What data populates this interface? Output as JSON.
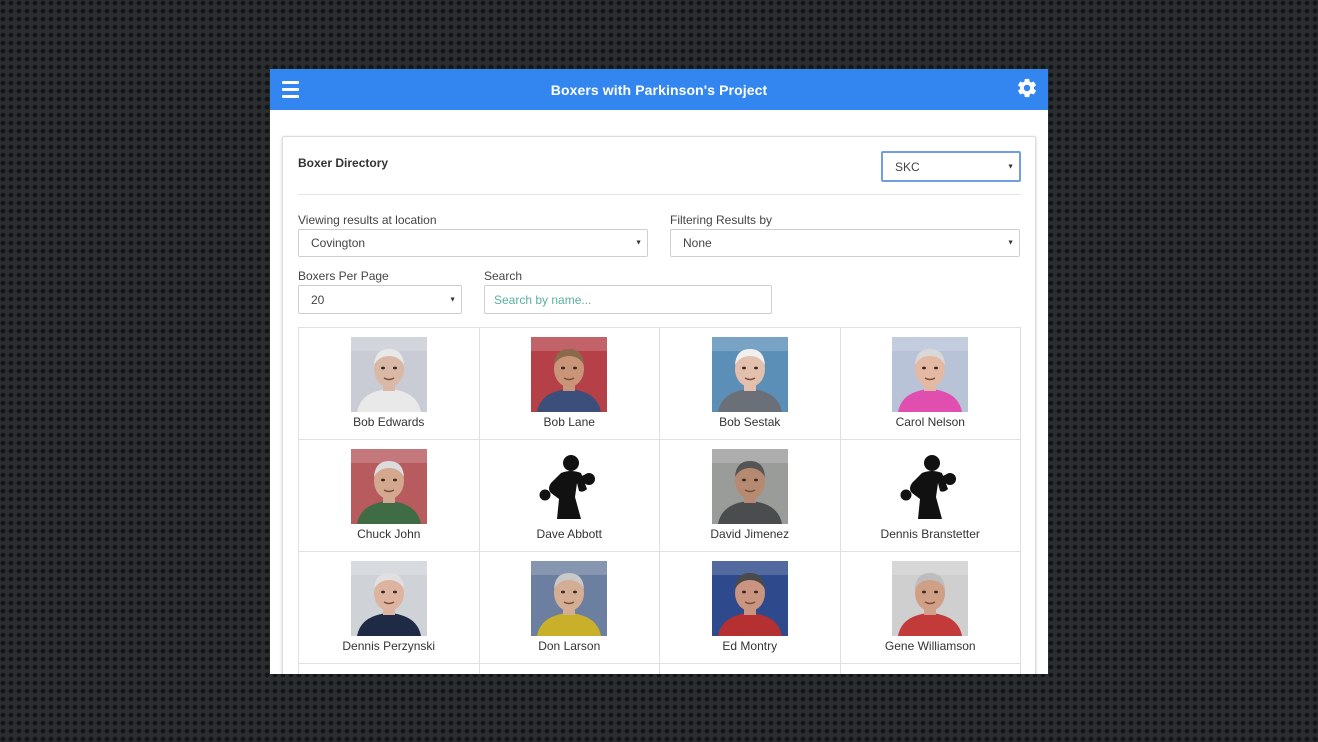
{
  "app": {
    "title": "Boxers with Parkinson's Project"
  },
  "directory": {
    "title": "Boxer Directory",
    "group_value": "SKC",
    "location_label": "Viewing results at location",
    "location_value": "Covington",
    "filter_label": "Filtering Results by",
    "filter_value": "None",
    "perpage_label": "Boxers Per Page",
    "perpage_value": "20",
    "search_label": "Search",
    "search_placeholder": "Search by name..."
  },
  "boxers": [
    {
      "name": "Bob Edwards",
      "photo": "photo",
      "bg": "#c9ccd4",
      "skin": "#d9b9a6",
      "hair": "#e8e8e8",
      "shirt": "#e9e9e9"
    },
    {
      "name": "Bob Lane",
      "photo": "photo",
      "bg": "#b54048",
      "skin": "#c99478",
      "hair": "#8a6a4a",
      "shirt": "#3b4f7a"
    },
    {
      "name": "Bob Sestak",
      "photo": "photo",
      "bg": "#5c8fb8",
      "skin": "#e2c0ad",
      "hair": "#f0f0f0",
      "shirt": "#6a6f78"
    },
    {
      "name": "Carol Nelson",
      "photo": "photo",
      "bg": "#b8c3d8",
      "skin": "#e3b9a3",
      "hair": "#d8d8d8",
      "shirt": "#e04fb0"
    },
    {
      "name": "Chuck John",
      "photo": "photo",
      "bg": "#b85b5e",
      "skin": "#d3a88e",
      "hair": "#dcdcdc",
      "shirt": "#3f6b45"
    },
    {
      "name": "Dave Abbott",
      "photo": "silhouette"
    },
    {
      "name": "David Jimenez",
      "photo": "photo",
      "bg": "#9a9c9a",
      "skin": "#b58a70",
      "hair": "#555555",
      "shirt": "#4a4c4e"
    },
    {
      "name": "Dennis Branstetter",
      "photo": "silhouette"
    },
    {
      "name": "Dennis Perzynski",
      "photo": "photo",
      "bg": "#cfd3d8",
      "skin": "#dcb4a0",
      "hair": "#e0e0e0",
      "shirt": "#1f2a44"
    },
    {
      "name": "Don Larson",
      "photo": "photo",
      "bg": "#6c7fa0",
      "skin": "#d4ad95",
      "hair": "#c9c9c9",
      "shirt": "#c8b02a"
    },
    {
      "name": "Ed Montry",
      "photo": "photo",
      "bg": "#2e4a8c",
      "skin": "#c99480",
      "hair": "#4a4a4a",
      "shirt": "#b53030"
    },
    {
      "name": "Gene Williamson",
      "photo": "photo",
      "bg": "#cfcfcf",
      "skin": "#cf9f86",
      "hair": "#bdbdbd",
      "shirt": "#c23a3a"
    },
    {
      "name": "",
      "photo": "none"
    },
    {
      "name": "",
      "photo": "none"
    },
    {
      "name": "",
      "photo": "none"
    },
    {
      "name": "",
      "photo": "none"
    }
  ],
  "colors": {
    "header": "#3385f0",
    "accent_border": "#6f9fe0",
    "placeholder": "#5ab0a0"
  },
  "icons": {
    "menu": "hamburger-menu-icon",
    "settings": "gear-icon",
    "dropdown": "caret-down-icon"
  }
}
